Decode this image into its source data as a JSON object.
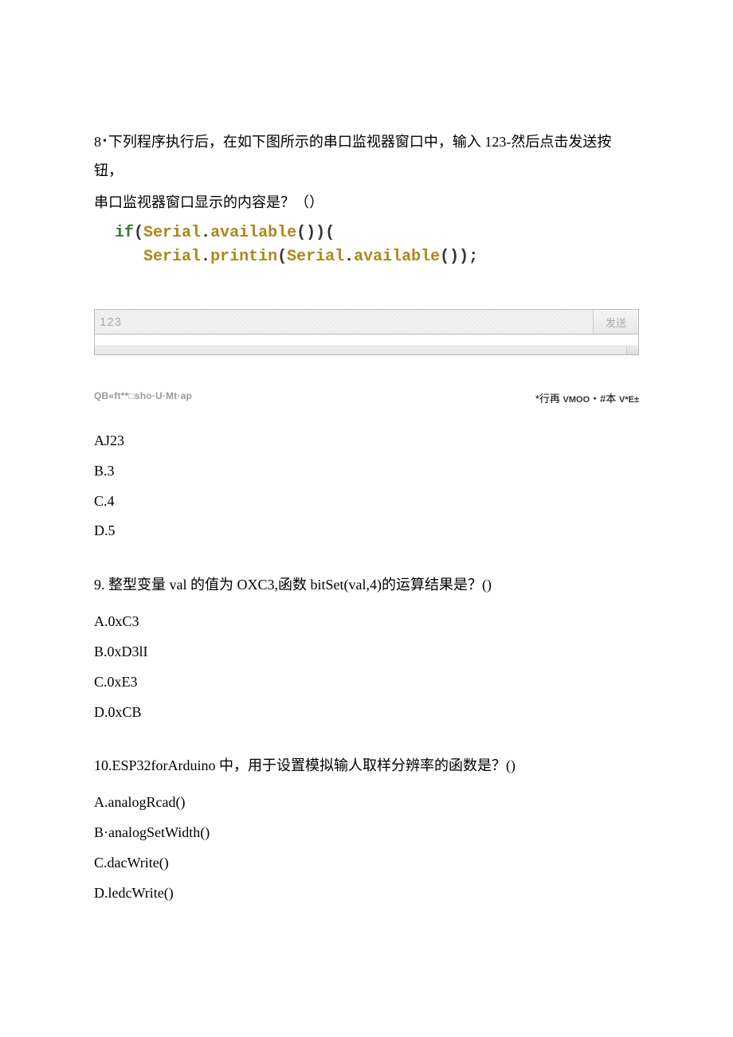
{
  "q8": {
    "number": "8",
    "bullet": "•",
    "text1": "下列程序执行后，在如下图所示的串口监视器窗口中，输入 123-然后点击发送按钮，",
    "text2": "串口监视器窗口显示的内容是？（）",
    "code": {
      "l1_if": "if",
      "l1_open": "(",
      "l1_obj": "Serial",
      "l1_dot": ".",
      "l1_fn": "available",
      "l1_p": "()",
      "l1_close": ")",
      "l1_brace": "(",
      "l2_indent": "   ",
      "l2_obj": "Serial",
      "l2_dot": ".",
      "l2_fn": "printin",
      "l2_open": "(",
      "l2_obj2": "Serial",
      "l2_dot2": ".",
      "l2_fn2": "available",
      "l2_p": "()",
      "l2_close": ")",
      "l2_semi": ";"
    },
    "serial": {
      "input": "123",
      "send": "发送"
    },
    "foot_left": "QB«ft**□sho·U·Mt·ap",
    "foot_right_pre": "*行再 ",
    "foot_right_a": "VMOO",
    "foot_right_mid": "・#本 ",
    "foot_right_b": "V*E±",
    "options": {
      "A": "AJ23",
      "B": "B.3",
      "C": "C.4",
      "D": "D.5"
    }
  },
  "q9": {
    "text": "9. 整型变量 val 的值为 OXC3,函数 bitSet(val,4)的运算结果是？()",
    "options": {
      "A": "A.0xC3",
      "B": "B.0xD3lI",
      "C": "C.0xE3",
      "D": "D.0xCB"
    }
  },
  "q10": {
    "text": "10.ESP32forArduino 中，用于设置模拟输人取样分辨率的函数是？()",
    "options": {
      "A": "A.analogRcad()",
      "B": "B·analogSetWidth()",
      "C": "C.dacWrite()",
      "D": "D.ledcWrite()"
    }
  }
}
